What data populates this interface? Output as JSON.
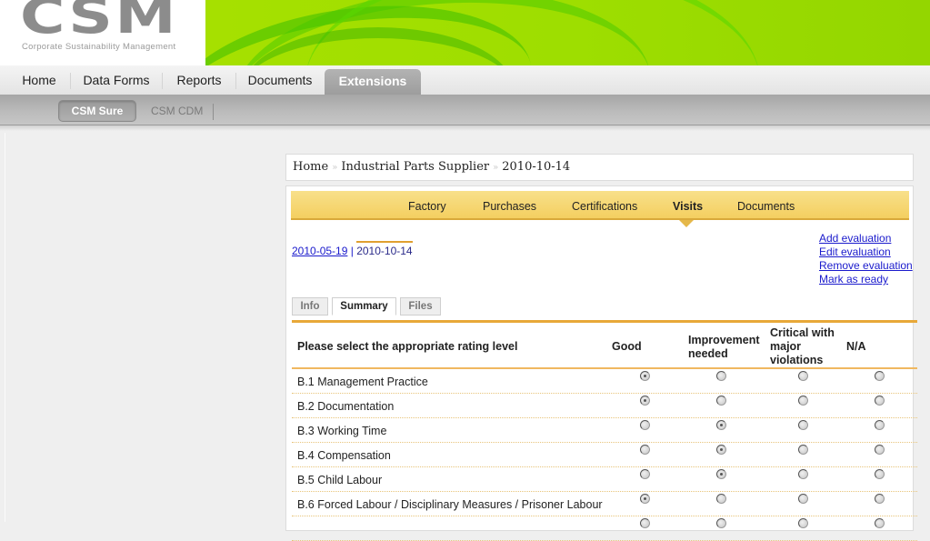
{
  "header": {
    "logo_text": "CSM",
    "logo_subtitle": "Corporate Sustainability Management"
  },
  "main_nav": {
    "items": [
      {
        "label": "Home",
        "active": false
      },
      {
        "label": "Data Forms",
        "active": false
      },
      {
        "label": "Reports",
        "active": false
      },
      {
        "label": "Documents",
        "active": false
      },
      {
        "label": "Extensions",
        "active": true
      }
    ]
  },
  "sub_nav": {
    "items": [
      {
        "label": "CSM Sure",
        "active": true
      },
      {
        "label": "CSM CDM",
        "active": false
      }
    ]
  },
  "breadcrumb": {
    "items": [
      "Home",
      "Industrial Parts Supplier",
      "2010-10-14"
    ],
    "separator": "»"
  },
  "section_tabs": {
    "items": [
      {
        "label": "Factory",
        "active": false
      },
      {
        "label": "Purchases",
        "active": false
      },
      {
        "label": "Certifications",
        "active": false
      },
      {
        "label": "Visits",
        "active": true
      },
      {
        "label": "Documents",
        "active": false
      }
    ]
  },
  "visit_dates": {
    "link": "2010-05-19",
    "separator": "|",
    "current": "2010-10-14"
  },
  "actions": {
    "add": "Add evaluation",
    "edit": "Edit evaluation",
    "remove": "Remove evaluation",
    "mark_ready": "Mark as ready"
  },
  "sub_tabs": {
    "items": [
      {
        "label": "Info",
        "active": false
      },
      {
        "label": "Summary",
        "active": true
      },
      {
        "label": "Files",
        "active": false
      }
    ]
  },
  "rating_table": {
    "header": {
      "prompt": "Please select the appropriate rating level",
      "columns": [
        "Good",
        "Improvement needed",
        "Critical with major violations",
        "N/A"
      ]
    },
    "rows": [
      {
        "label": "B.1 Management Practice",
        "selected": 0
      },
      {
        "label": "B.2 Documentation",
        "selected": 0
      },
      {
        "label": "B.3 Working Time",
        "selected": 1
      },
      {
        "label": "B.4 Compensation",
        "selected": 1
      },
      {
        "label": "B.5 Child Labour",
        "selected": 1
      },
      {
        "label": "B.6 Forced Labour / Disciplinary Measures / Prisoner Labour",
        "selected": 0
      },
      {
        "label": "",
        "selected": -1
      }
    ]
  },
  "colors": {
    "accent_orange": "#e8a838",
    "tab_yellow": "#f4cf60",
    "banner_green": "#9ede00",
    "link_blue": "#1a1acc"
  }
}
